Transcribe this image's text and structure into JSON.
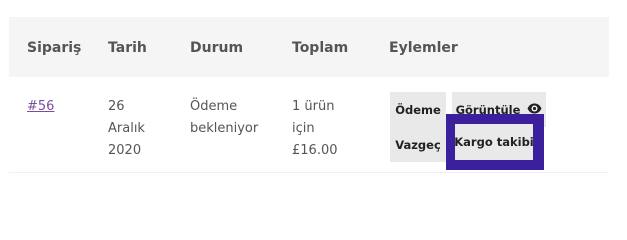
{
  "table": {
    "headers": {
      "order": "Sipariş",
      "date": "Tarih",
      "status": "Durum",
      "total": "Toplam",
      "actions": "Eylemler"
    },
    "rows": [
      {
        "order_link": "#56",
        "date_lines": [
          "26",
          "Aralık",
          "2020"
        ],
        "status_lines": [
          "Ödeme",
          "bekleniyor"
        ],
        "total_lines": [
          "1 ürün",
          "için",
          "£16.00"
        ],
        "actions": {
          "pay_label": "Ödeme",
          "view_label": "Görüntüle",
          "view_icon": "eye-icon",
          "cancel_label": "Vazgeç",
          "tracking_label": "Kargo takibi"
        }
      }
    ]
  },
  "colors": {
    "header_bg": "#f5f5f5",
    "button_bg": "#e9e9e9",
    "focus_ring": "#3c1f9c",
    "link": "#7b4fa0"
  }
}
